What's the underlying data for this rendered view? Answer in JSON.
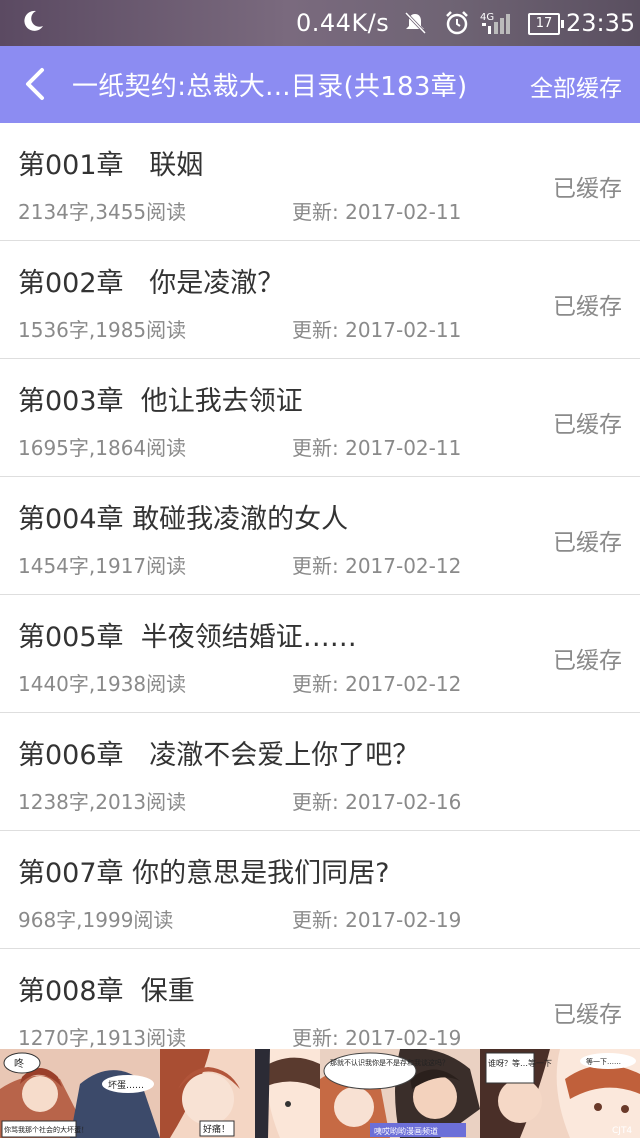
{
  "status": {
    "speed": "0.44K/s",
    "battery": "17",
    "time": "23:35",
    "icons": [
      "moon-icon",
      "mute-icon",
      "alarm-icon",
      "signal-4g-icon",
      "battery-icon"
    ]
  },
  "header": {
    "title": "一纸契约:总裁大...目录(共183章)",
    "cache_all": "全部缓存"
  },
  "chapters": [
    {
      "chapter": "第001章",
      "title": "联姻",
      "words": "2134字,3455阅读",
      "updated": "更新: 2017-02-11",
      "cached": "已缓存",
      "gap": "   "
    },
    {
      "chapter": "第002章",
      "title": "你是凌澈？",
      "words": "1536字,1985阅读",
      "updated": "更新: 2017-02-11",
      "cached": "已缓存",
      "gap": "   "
    },
    {
      "chapter": "第003章",
      "title": "他让我去领证",
      "words": "1695字,1864阅读",
      "updated": "更新: 2017-02-11",
      "cached": "已缓存",
      "gap": "  "
    },
    {
      "chapter": "第004章",
      "title": "敢碰我凌澈的女人",
      "words": "1454字,1917阅读",
      "updated": "更新: 2017-02-12",
      "cached": "已缓存",
      "gap": " "
    },
    {
      "chapter": "第005章",
      "title": "半夜领结婚证……",
      "words": "1440字,1938阅读",
      "updated": "更新: 2017-02-12",
      "cached": "已缓存",
      "gap": "  "
    },
    {
      "chapter": "第006章",
      "title": "凌澈不会爱上你了吧？",
      "words": "1238字,2013阅读",
      "updated": "更新: 2017-02-16",
      "cached": "",
      "gap": "   "
    },
    {
      "chapter": "第007章",
      "title": "你的意思是我们同居?",
      "words": "968字,1999阅读",
      "updated": "更新: 2017-02-19",
      "cached": "",
      "gap": " "
    },
    {
      "chapter": "第008章",
      "title": "保重",
      "words": "1270字,1913阅读",
      "updated": "更新: 2017-02-19",
      "cached": "已缓存",
      "gap": "  "
    }
  ],
  "banner": {
    "bubbles": [
      "咚",
      "坏蛋……",
      "你骂我那个社会的大坏蛋！",
      "好痛！",
      "那就不认识我你是不是存和我谈这吗？",
      "咦哎哟哟漫画频道",
      "谁呀？等…等一下",
      "等一下……"
    ],
    "badge": "CJT4"
  }
}
